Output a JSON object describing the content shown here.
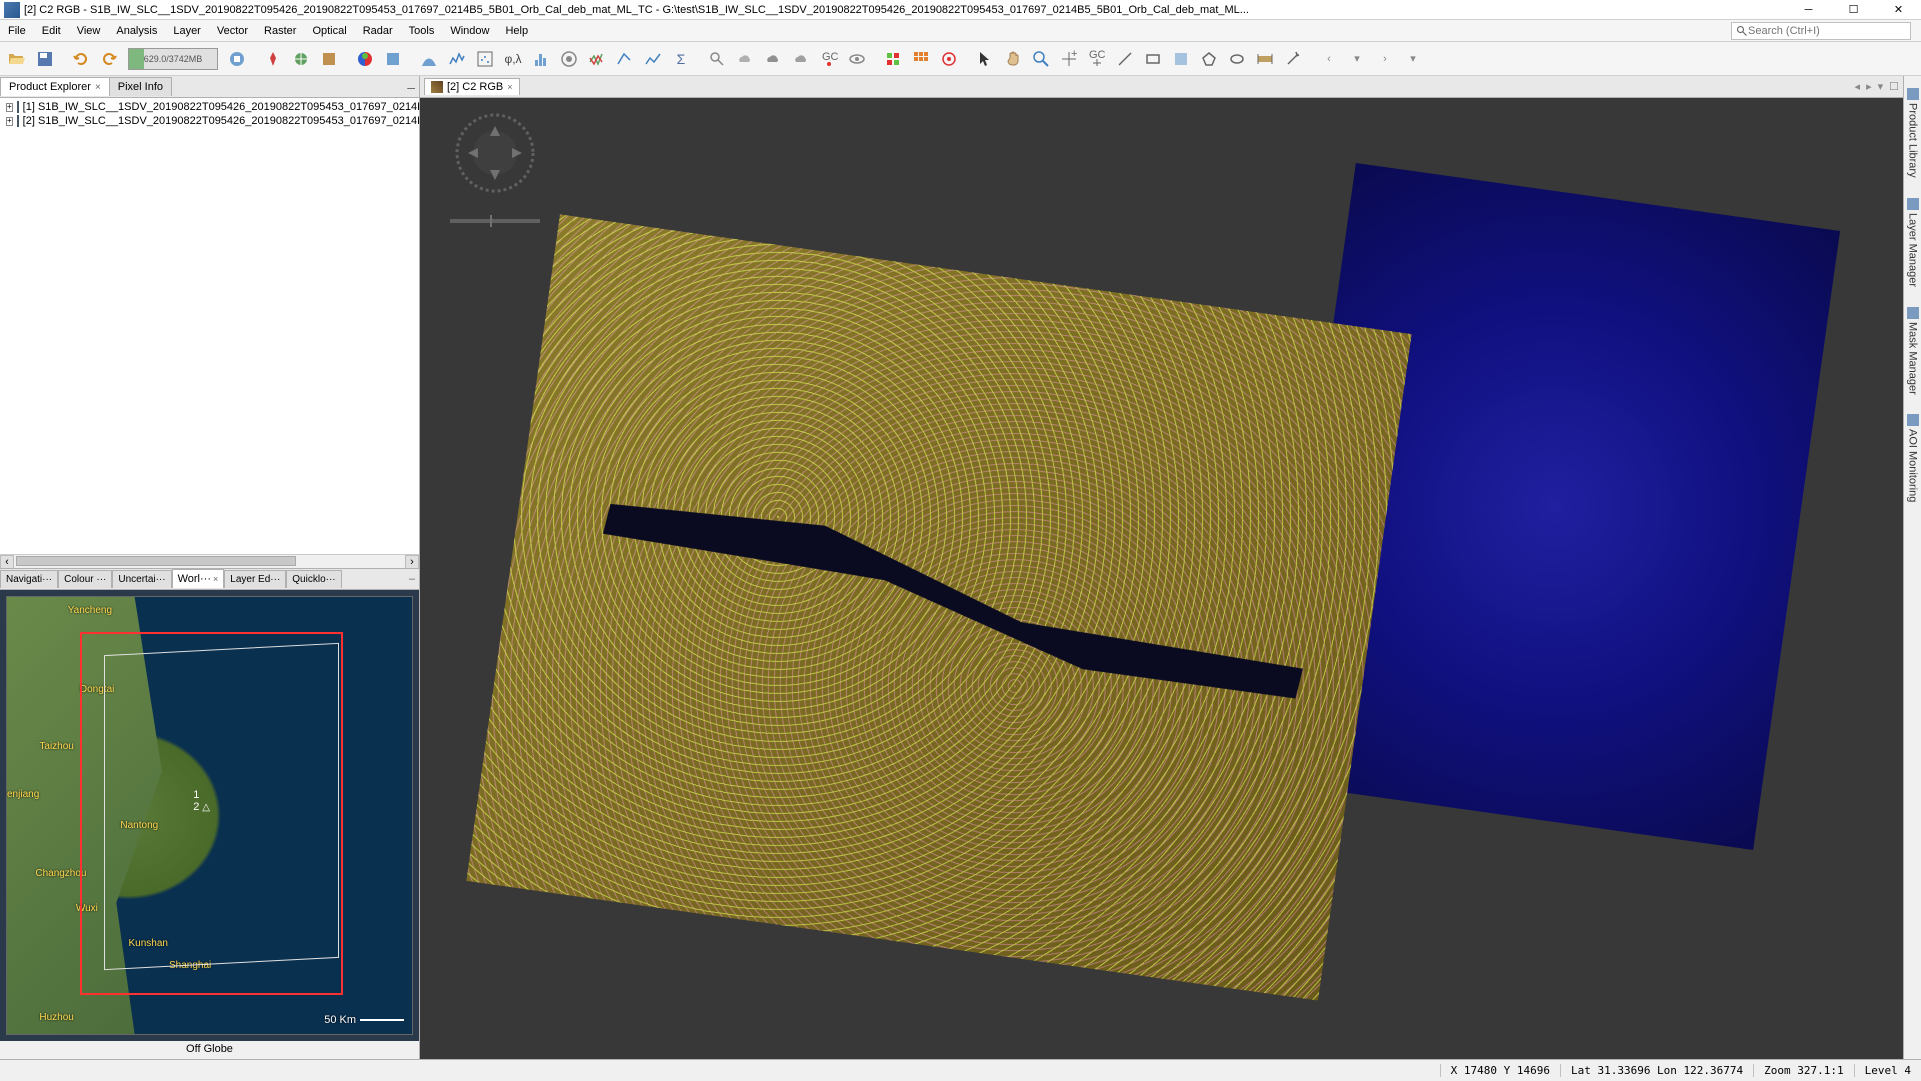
{
  "titlebar": {
    "title": "[2] C2 RGB - S1B_IW_SLC__1SDV_20190822T095426_20190822T095453_017697_0214B5_5B01_Orb_Cal_deb_mat_ML_TC - G:\\test\\S1B_IW_SLC__1SDV_20190822T095426_20190822T095453_017697_0214B5_5B01_Orb_Cal_deb_mat_ML..."
  },
  "menus": [
    "File",
    "Edit",
    "View",
    "Analysis",
    "Layer",
    "Vector",
    "Raster",
    "Optical",
    "Radar",
    "Tools",
    "Window",
    "Help"
  ],
  "search_placeholder": "Search (Ctrl+I)",
  "memory": "629.0/3742MB",
  "left": {
    "tabs": {
      "explorer": "Product Explorer",
      "pixel": "Pixel Info"
    },
    "products": [
      "[1] S1B_IW_SLC__1SDV_20190822T095426_20190822T095453_017697_0214B5_",
      "[2] S1B_IW_SLC__1SDV_20190822T095426_20190822T095453_017697_0214B5_"
    ],
    "bottom_tabs": {
      "nav": "Navigati···",
      "colour": "Colour ···",
      "uncert": "Uncertai···",
      "world": "Worl···",
      "layer": "Layer Ed···",
      "quick": "Quicklo···"
    },
    "world": {
      "cities": {
        "yancheng": "Yancheng",
        "dongtai": "Dongtai",
        "taizhou": "Taizhou",
        "enjiang": "enjiang",
        "nantong": "Nantong",
        "changzhou": "Changzhou",
        "wuxi": "Wuxi",
        "kunshan": "Kunshan",
        "shanghai": "Shanghai",
        "huzhou": "Huzhou"
      },
      "pin1": "1",
      "pin2": "2",
      "scale": "50 Km",
      "status": "Off Globe"
    }
  },
  "image_tab": "[2] C2 RGB",
  "right_tabs": {
    "product_library": "Product Library",
    "layer_manager": "Layer Manager",
    "mask_manager": "Mask Manager",
    "aoi": "AOI Monitoring"
  },
  "status": {
    "xy": "X  17480  Y  14696",
    "latlon": "Lat 31.33696  Lon 122.36774",
    "zoom": "Zoom 327.1:1",
    "level": "Level 4"
  }
}
